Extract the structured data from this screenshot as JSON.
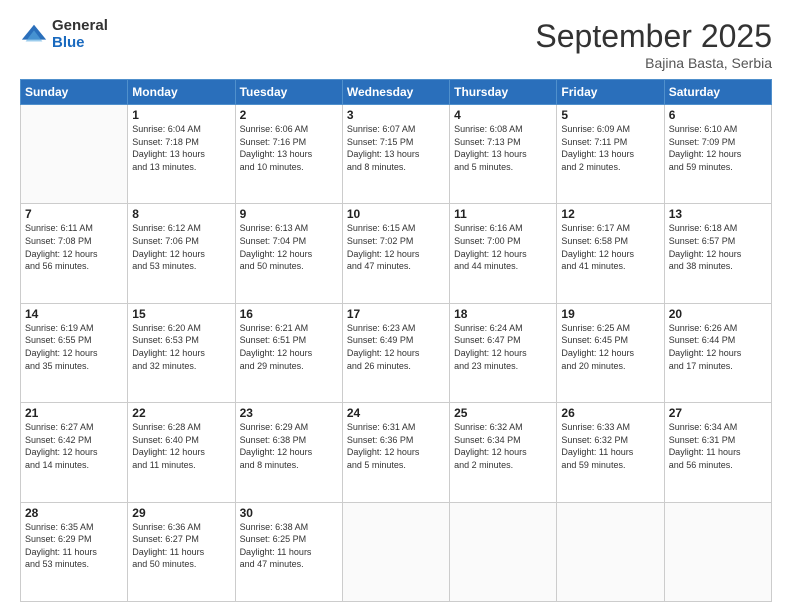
{
  "logo": {
    "general": "General",
    "blue": "Blue"
  },
  "title": "September 2025",
  "subtitle": "Bajina Basta, Serbia",
  "days_of_week": [
    "Sunday",
    "Monday",
    "Tuesday",
    "Wednesday",
    "Thursday",
    "Friday",
    "Saturday"
  ],
  "weeks": [
    [
      {
        "day": "",
        "info": ""
      },
      {
        "day": "1",
        "info": "Sunrise: 6:04 AM\nSunset: 7:18 PM\nDaylight: 13 hours\nand 13 minutes."
      },
      {
        "day": "2",
        "info": "Sunrise: 6:06 AM\nSunset: 7:16 PM\nDaylight: 13 hours\nand 10 minutes."
      },
      {
        "day": "3",
        "info": "Sunrise: 6:07 AM\nSunset: 7:15 PM\nDaylight: 13 hours\nand 8 minutes."
      },
      {
        "day": "4",
        "info": "Sunrise: 6:08 AM\nSunset: 7:13 PM\nDaylight: 13 hours\nand 5 minutes."
      },
      {
        "day": "5",
        "info": "Sunrise: 6:09 AM\nSunset: 7:11 PM\nDaylight: 13 hours\nand 2 minutes."
      },
      {
        "day": "6",
        "info": "Sunrise: 6:10 AM\nSunset: 7:09 PM\nDaylight: 12 hours\nand 59 minutes."
      }
    ],
    [
      {
        "day": "7",
        "info": "Sunrise: 6:11 AM\nSunset: 7:08 PM\nDaylight: 12 hours\nand 56 minutes."
      },
      {
        "day": "8",
        "info": "Sunrise: 6:12 AM\nSunset: 7:06 PM\nDaylight: 12 hours\nand 53 minutes."
      },
      {
        "day": "9",
        "info": "Sunrise: 6:13 AM\nSunset: 7:04 PM\nDaylight: 12 hours\nand 50 minutes."
      },
      {
        "day": "10",
        "info": "Sunrise: 6:15 AM\nSunset: 7:02 PM\nDaylight: 12 hours\nand 47 minutes."
      },
      {
        "day": "11",
        "info": "Sunrise: 6:16 AM\nSunset: 7:00 PM\nDaylight: 12 hours\nand 44 minutes."
      },
      {
        "day": "12",
        "info": "Sunrise: 6:17 AM\nSunset: 6:58 PM\nDaylight: 12 hours\nand 41 minutes."
      },
      {
        "day": "13",
        "info": "Sunrise: 6:18 AM\nSunset: 6:57 PM\nDaylight: 12 hours\nand 38 minutes."
      }
    ],
    [
      {
        "day": "14",
        "info": "Sunrise: 6:19 AM\nSunset: 6:55 PM\nDaylight: 12 hours\nand 35 minutes."
      },
      {
        "day": "15",
        "info": "Sunrise: 6:20 AM\nSunset: 6:53 PM\nDaylight: 12 hours\nand 32 minutes."
      },
      {
        "day": "16",
        "info": "Sunrise: 6:21 AM\nSunset: 6:51 PM\nDaylight: 12 hours\nand 29 minutes."
      },
      {
        "day": "17",
        "info": "Sunrise: 6:23 AM\nSunset: 6:49 PM\nDaylight: 12 hours\nand 26 minutes."
      },
      {
        "day": "18",
        "info": "Sunrise: 6:24 AM\nSunset: 6:47 PM\nDaylight: 12 hours\nand 23 minutes."
      },
      {
        "day": "19",
        "info": "Sunrise: 6:25 AM\nSunset: 6:45 PM\nDaylight: 12 hours\nand 20 minutes."
      },
      {
        "day": "20",
        "info": "Sunrise: 6:26 AM\nSunset: 6:44 PM\nDaylight: 12 hours\nand 17 minutes."
      }
    ],
    [
      {
        "day": "21",
        "info": "Sunrise: 6:27 AM\nSunset: 6:42 PM\nDaylight: 12 hours\nand 14 minutes."
      },
      {
        "day": "22",
        "info": "Sunrise: 6:28 AM\nSunset: 6:40 PM\nDaylight: 12 hours\nand 11 minutes."
      },
      {
        "day": "23",
        "info": "Sunrise: 6:29 AM\nSunset: 6:38 PM\nDaylight: 12 hours\nand 8 minutes."
      },
      {
        "day": "24",
        "info": "Sunrise: 6:31 AM\nSunset: 6:36 PM\nDaylight: 12 hours\nand 5 minutes."
      },
      {
        "day": "25",
        "info": "Sunrise: 6:32 AM\nSunset: 6:34 PM\nDaylight: 12 hours\nand 2 minutes."
      },
      {
        "day": "26",
        "info": "Sunrise: 6:33 AM\nSunset: 6:32 PM\nDaylight: 11 hours\nand 59 minutes."
      },
      {
        "day": "27",
        "info": "Sunrise: 6:34 AM\nSunset: 6:31 PM\nDaylight: 11 hours\nand 56 minutes."
      }
    ],
    [
      {
        "day": "28",
        "info": "Sunrise: 6:35 AM\nSunset: 6:29 PM\nDaylight: 11 hours\nand 53 minutes."
      },
      {
        "day": "29",
        "info": "Sunrise: 6:36 AM\nSunset: 6:27 PM\nDaylight: 11 hours\nand 50 minutes."
      },
      {
        "day": "30",
        "info": "Sunrise: 6:38 AM\nSunset: 6:25 PM\nDaylight: 11 hours\nand 47 minutes."
      },
      {
        "day": "",
        "info": ""
      },
      {
        "day": "",
        "info": ""
      },
      {
        "day": "",
        "info": ""
      },
      {
        "day": "",
        "info": ""
      }
    ]
  ]
}
